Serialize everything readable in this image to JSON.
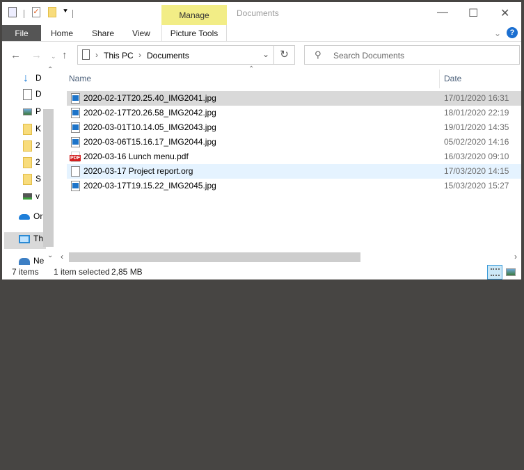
{
  "titlebar": {
    "manage_label": "Manage",
    "title": "Documents",
    "minimize": "—",
    "maximize": "☐",
    "close": "✕"
  },
  "ribbon": {
    "tabs": [
      "File",
      "Home",
      "Share",
      "View"
    ],
    "picture_tools": "Picture Tools",
    "collapse": "⌄",
    "help": "?"
  },
  "address": {
    "crumbs": [
      "This PC",
      "Documents"
    ],
    "search_placeholder": "Search Documents"
  },
  "sidebar": {
    "items": [
      {
        "label": "D",
        "icon": "download"
      },
      {
        "label": "D",
        "icon": "document"
      },
      {
        "label": "P",
        "icon": "pictures"
      },
      {
        "label": "K",
        "icon": "folder"
      },
      {
        "label": "2",
        "icon": "folder"
      },
      {
        "label": "2",
        "icon": "folder"
      },
      {
        "label": "S",
        "icon": "folder"
      },
      {
        "label": "v",
        "icon": "network-drive"
      },
      {
        "label": "Or",
        "icon": "onedrive"
      },
      {
        "label": "Th",
        "icon": "this-pc"
      },
      {
        "label": "Ne",
        "icon": "network"
      }
    ]
  },
  "columns": {
    "name": "Name",
    "date": "Date"
  },
  "files": [
    {
      "name": "2020-02-17T20.25.40_IMG2041.jpg",
      "date": "17/01/2020 16:31",
      "type": "img"
    },
    {
      "name": "2020-02-17T20.26.58_IMG2042.jpg",
      "date": "18/01/2020 22:19",
      "type": "img"
    },
    {
      "name": "2020-03-01T10.14.05_IMG2043.jpg",
      "date": "19/01/2020 14:35",
      "type": "img"
    },
    {
      "name": "2020-03-06T15.16.17_IMG2044.jpg",
      "date": "05/02/2020 14:16",
      "type": "img"
    },
    {
      "name": "2020-03-16 Lunch menu.pdf",
      "date": "16/03/2020 09:10",
      "type": "pdf"
    },
    {
      "name": "2020-03-17 Project report.org",
      "date": "17/03/2020 14:15",
      "type": "doc"
    },
    {
      "name": "2020-03-17T19.15.22_IMG2045.jpg",
      "date": "15/03/2020 15:27",
      "type": "img"
    }
  ],
  "pdf_badge": "PDF",
  "status": {
    "count": "7 items",
    "selection": "1 item selected",
    "size": "2,85 MB"
  }
}
